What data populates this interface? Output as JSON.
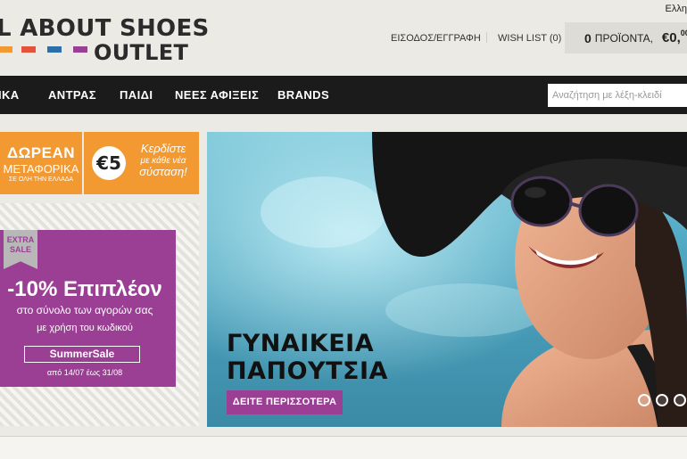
{
  "header": {
    "language_label": "Ελλη",
    "logo_line1": "L ABOUT SHOES",
    "logo_line2": "OUTLET",
    "logo_colors": [
      "#f29a31",
      "#e2533a",
      "#2d6fa8",
      "#9a3f93"
    ],
    "login_link": "ΕΙΣΟΔΟΣ/ΕΓΓΡΑΦΗ",
    "wishlist_link": "WISH LIST (0)",
    "cart": {
      "count": "0",
      "label": "ΠΡΟΪΟΝΤΑ,",
      "price_main": "€0,",
      "price_cents": "00"
    }
  },
  "nav": {
    "items": [
      "ΙΚΑ",
      "ΑΝΤΡΑΣ",
      "ΠΑΙΔΙ",
      "ΝΕΕΣ ΑΦΙΞΕΙΣ",
      "BRANDS"
    ],
    "search_placeholder": "Αναζήτηση με λέξη-κλειδί"
  },
  "promos": {
    "free_shipping": {
      "line1": "ΔΩΡΕΑΝ",
      "line2": "ΜΕΤΑΦΟΡΙΚΑ",
      "line3": "ΣΕ ΟΛΗ ΤΗΝ ΕΛΛΑΔΑ"
    },
    "referral": {
      "amount": "€5",
      "line1": "Κερδίστε",
      "line2": "με κάθε νέα",
      "line3": "σύσταση!"
    },
    "extra_sale": {
      "ribbon_line1": "EXTRA",
      "ribbon_line2": "SALE",
      "headline": "-10% Επιπλέον",
      "subline": "στο σύνολο των αγορών σας",
      "code_intro": "με χρήση του κωδικού",
      "code": "SummerSale",
      "dates": "από 14/07 έως 31/08"
    }
  },
  "hero": {
    "title_line1": "ΓΥΝΑΙΚΕΙΑ",
    "title_line2": "ΠΑΠΟΥΤΣΙΑ",
    "button_label": "ΔΕΙΤΕ ΠΕΡΙΣΣΟΤΕΡΑ",
    "slide_count": 3,
    "accent_color": "#9a3f93"
  },
  "colors": {
    "promo_orange": "#f29a31",
    "promo_purple": "#9a3f93",
    "nav_bg": "#1b1b1b"
  }
}
